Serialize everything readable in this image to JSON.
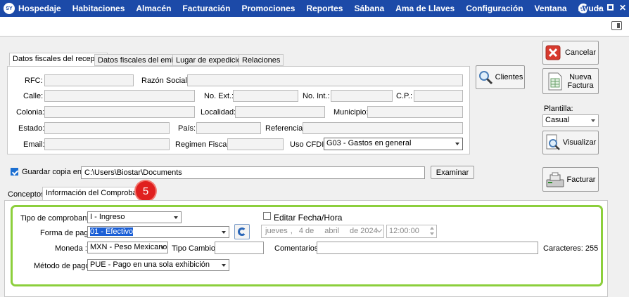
{
  "menu": {
    "logo_text": "SY",
    "items": [
      "Hospedaje",
      "Habitaciones",
      "Almacén",
      "Facturación",
      "Promociones",
      "Reportes",
      "Sábana",
      "Ama de Llaves",
      "Configuración",
      "Ventana",
      "Ayuda"
    ],
    "brand_color": "#1c4aa8"
  },
  "receptor": {
    "tabs": [
      "Datos fiscales del receptor",
      "Datos fiscales del emisor",
      "Lugar de expedición",
      "Relaciones"
    ],
    "labels": {
      "rfc": "RFC:",
      "razon_social": "Razón Social:",
      "calle": "Calle:",
      "no_ext": "No. Ext.:",
      "no_int": "No. Int.:",
      "cp": "C.P.:",
      "colonia": "Colonia:",
      "localidad": "Localidad:",
      "municipio": "Municipio:",
      "estado": "Estado:",
      "pais": "País:",
      "referencia": "Referencia:",
      "email": "Email:",
      "regimen_fiscal": "Regimen Fiscal:",
      "uso_cfdi": "Uso CFDI :"
    },
    "uso_cfdi_value": "G03 - Gastos en general"
  },
  "guardar": {
    "label": "Guardar copia en:",
    "path": "C:\\Users\\Biostar\\Documents",
    "examinar_label": "Examinar"
  },
  "buttons": {
    "clientes": "Clientes",
    "cancelar": "Cancelar",
    "nueva_factura_1": "Nueva",
    "nueva_factura_2": "Factura",
    "plantilla_label": "Plantilla:",
    "plantilla_value": "Casual",
    "visualizar": "Visualizar",
    "facturar": "Facturar"
  },
  "bottom_tabs": [
    "Conceptos",
    "Información del Comprobante"
  ],
  "step_badge": "5",
  "comprobante": {
    "tipo_label": "Tipo de comprobante:",
    "tipo_value": "I - Ingreso",
    "editar_label": "Editar Fecha/Hora",
    "forma_label": "Forma de pago:",
    "forma_value": "01 - Efectivo",
    "fecha": {
      "weekday": "jueves",
      "sep1": ",",
      "day": "4",
      "de1": "de",
      "month": "abril",
      "de2": "de",
      "year": "2024"
    },
    "hora": "12:00:00",
    "moneda_label": "Moneda :",
    "moneda_value": "MXN - Peso Mexicano",
    "tipo_cambio_label": "Tipo Cambio:",
    "comentarios_label": "Comentarios:",
    "caracteres_label": "Caracteres: 255",
    "metodo_label": "Método de pago:",
    "metodo_value": "PUE - Pago en una sola exhibición"
  }
}
